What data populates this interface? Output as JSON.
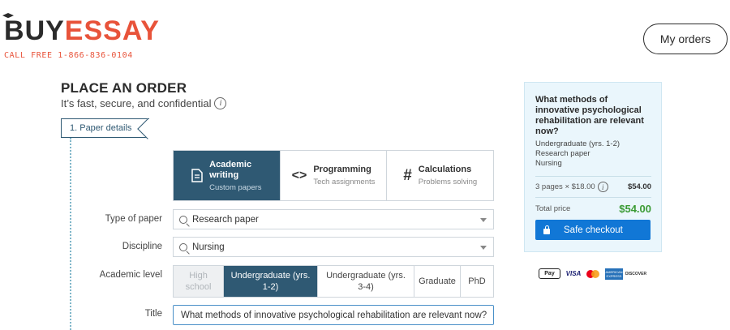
{
  "header": {
    "logo_first": "B",
    "logo_dark": "UY",
    "logo_accent": "ESSAY",
    "phone": "CALL FREE 1-866-836-0104",
    "my_orders": "My orders"
  },
  "page": {
    "title": "PLACE AN ORDER",
    "subtitle": "It’s fast, secure, and confidential",
    "info_glyph": "i",
    "step_label": "1.  Paper details"
  },
  "work_types": [
    {
      "icon": "document-icon",
      "title": "Academic writing",
      "subtitle": "Custom papers",
      "active": true
    },
    {
      "icon": "code-icon",
      "title": "Programming",
      "subtitle": "Tech assignments",
      "active": false
    },
    {
      "icon": "hash-icon",
      "title": "Calculations",
      "subtitle": "Problems solving",
      "active": false
    }
  ],
  "form": {
    "type_of_paper_label": "Type of paper",
    "type_of_paper_value": "Research paper",
    "discipline_label": "Discipline",
    "discipline_value": "Nursing",
    "academic_level_label": "Academic level",
    "levels": [
      {
        "label": "High school",
        "state": "disabled"
      },
      {
        "label": "Undergraduate (yrs. 1-2)",
        "state": "active"
      },
      {
        "label": "Undergraduate (yrs. 3-4)",
        "state": "normal"
      },
      {
        "label": "Graduate",
        "state": "normal"
      },
      {
        "label": "PhD",
        "state": "normal"
      }
    ],
    "title_label": "Title",
    "title_value": "What methods of innovative psychological rehabilitation are relevant now?"
  },
  "summary": {
    "title": "What methods of innovative psychological rehabilitation are relevant now?",
    "level": "Undergraduate (yrs. 1-2)",
    "paper_type": "Research paper",
    "discipline": "Nursing",
    "pages_line": "3 pages × $18.00",
    "pages_amount": "$54.00",
    "total_label": "Total price",
    "total_amount": "$54.00",
    "checkout": "Safe checkout"
  },
  "payments": {
    "applepay": "Pay",
    "visa": "VISA",
    "amex": "AMERICAN EXPRESS",
    "discover": "DISCOVER"
  },
  "colors": {
    "accent": "#e8533a",
    "primary": "#2f5973",
    "checkout": "#1177d6",
    "total": "#3b9b35"
  }
}
